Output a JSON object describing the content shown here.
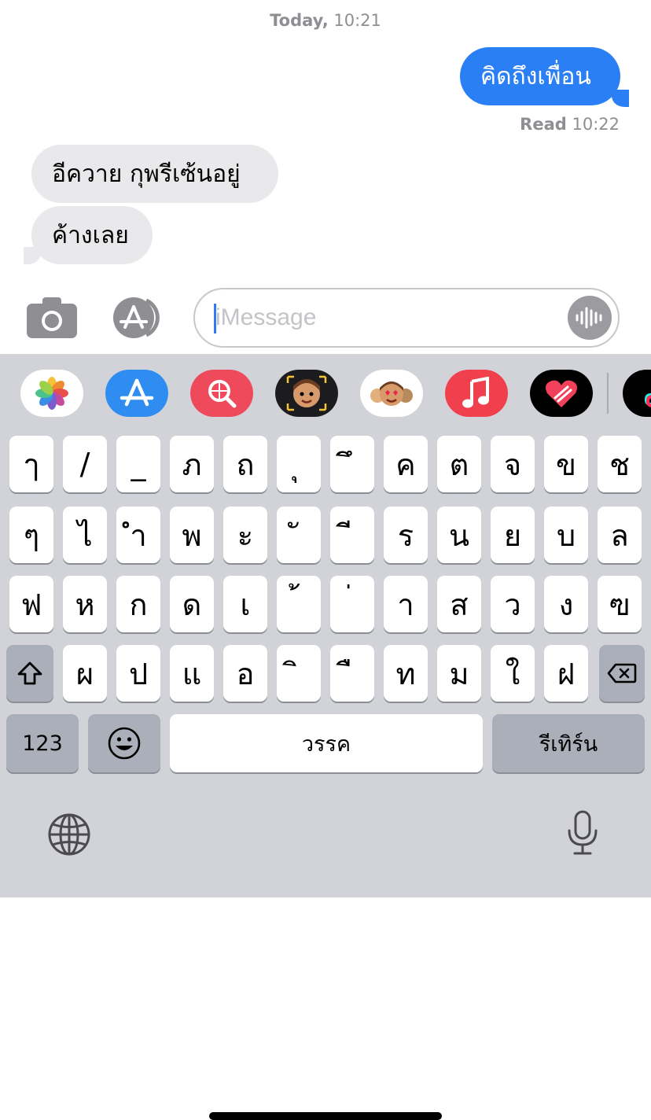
{
  "conversation": {
    "timestamp_day": "Today,",
    "timestamp_time": "10:21",
    "outgoing": [
      {
        "text": "คิดถึงเพื่อน"
      }
    ],
    "read_receipt_label": "Read",
    "read_receipt_time": "10:22",
    "incoming": [
      {
        "text": "อีควาย กุพรีเซ้นอยู่"
      },
      {
        "text": "ค้างเลย"
      }
    ]
  },
  "input_bar": {
    "camera_icon": "camera-icon",
    "apps_icon": "app-store-icon",
    "placeholder": "iMessage",
    "value": "",
    "audio_icon": "waveform-icon"
  },
  "app_strip": [
    {
      "name": "photos-app-icon"
    },
    {
      "name": "app-store-app-icon"
    },
    {
      "name": "images-search-app-icon"
    },
    {
      "name": "memoji-camera-app-icon"
    },
    {
      "name": "memoji-stickers-app-icon"
    },
    {
      "name": "music-app-icon"
    },
    {
      "name": "digital-touch-app-icon"
    },
    {
      "name": "tiktok-app-icon"
    }
  ],
  "keyboard": {
    "rows": [
      [
        "ๅ",
        "/",
        "_",
        "ภ",
        "ถ",
        "ุ",
        "ึ",
        "ค",
        "ต",
        "จ",
        "ข",
        "ช"
      ],
      [
        "ๆ",
        "ไ",
        "ำ",
        "พ",
        "ะ",
        "ั",
        "ี",
        "ร",
        "น",
        "ย",
        "บ",
        "ล"
      ],
      [
        "ฟ",
        "ห",
        "ก",
        "ด",
        "เ",
        "้",
        "่",
        "า",
        "ส",
        "ว",
        "ง",
        "ฃ"
      ],
      [
        "ผ",
        "ป",
        "แ",
        "อ",
        "ิ",
        "ื",
        "ท",
        "ม",
        "ใ",
        "ฝ"
      ]
    ],
    "numbers_label": "123",
    "space_label": "วรรค",
    "return_label": "รีเทิร์น",
    "shift_icon": "shift-icon",
    "delete_icon": "delete-icon",
    "emoji_icon": "emoji-icon",
    "globe_icon": "globe-icon",
    "mic_icon": "microphone-icon"
  },
  "colors": {
    "outgoing_bubble": "#2b7ff5",
    "incoming_bubble": "#e9e9eb",
    "keyboard_bg": "#d1d3d9",
    "caret": "#3478f6"
  }
}
